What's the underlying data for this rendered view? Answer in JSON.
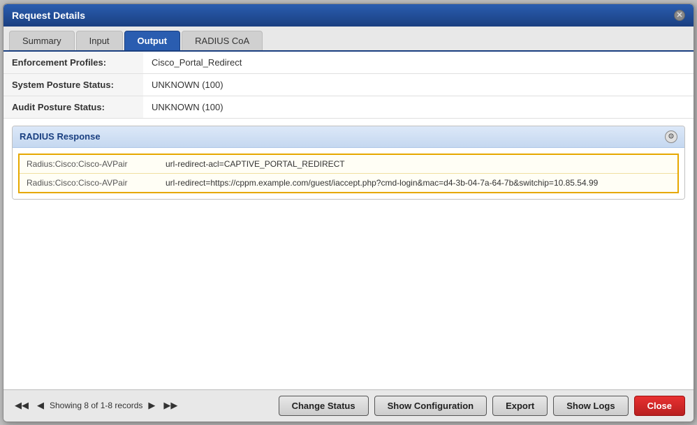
{
  "dialog": {
    "title": "Request Details",
    "close_label": "×"
  },
  "tabs": [
    {
      "label": "Summary",
      "active": false
    },
    {
      "label": "Input",
      "active": false
    },
    {
      "label": "Output",
      "active": true
    },
    {
      "label": "RADIUS CoA",
      "active": false
    }
  ],
  "fields": [
    {
      "label": "Enforcement Profiles:",
      "value": "Cisco_Portal_Redirect"
    },
    {
      "label": "System Posture Status:",
      "value": "UNKNOWN (100)"
    },
    {
      "label": "Audit Posture Status:",
      "value": "UNKNOWN (100)"
    }
  ],
  "radius_section": {
    "header": "RADIUS Response",
    "rows": [
      {
        "key": "Radius:Cisco:Cisco-AVPair",
        "value": "url-redirect-acl=CAPTIVE_PORTAL_REDIRECT"
      },
      {
        "key": "Radius:Cisco:Cisco-AVPair",
        "value": "url-redirect=https://cppm.example.com/guest/iaccept.php?cmd-login&mac=d4-3b-04-7a-64-7b&switchip=10.85.54.99"
      }
    ]
  },
  "footer": {
    "paging_text": "Showing 8 of 1-8 records",
    "first_label": "◀◀",
    "prev_label": "◀",
    "next_label": "▶",
    "last_label": "▶▶",
    "buttons": [
      {
        "label": "Change Status",
        "type": "normal"
      },
      {
        "label": "Show Configuration",
        "type": "normal"
      },
      {
        "label": "Export",
        "type": "normal"
      },
      {
        "label": "Show Logs",
        "type": "normal"
      },
      {
        "label": "Close",
        "type": "close"
      }
    ]
  }
}
